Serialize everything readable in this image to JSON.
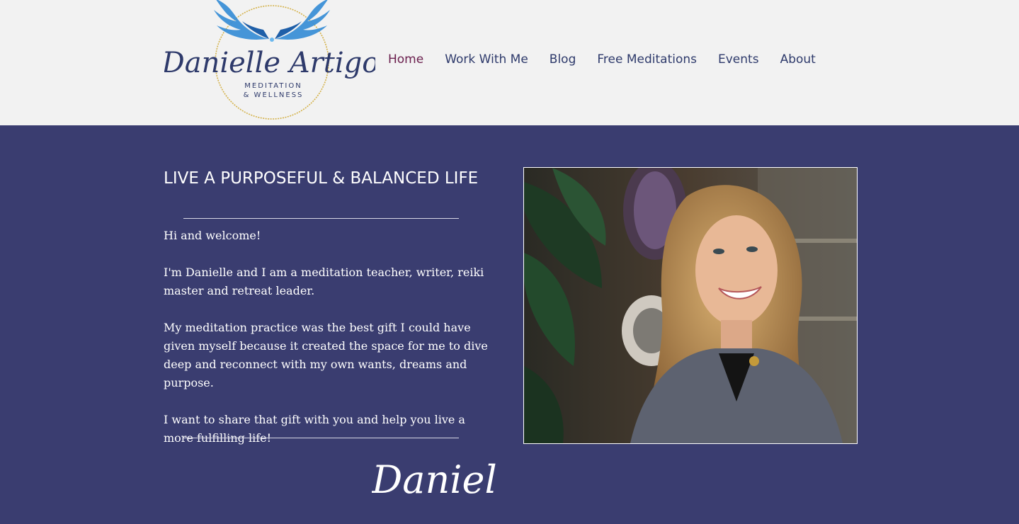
{
  "brand": {
    "logo_name": "Danielle Artigo",
    "logo_tagline_1": "MEDITATION",
    "logo_tagline_2": "& WELLNESS"
  },
  "nav": {
    "items": [
      {
        "label": "Home",
        "active": true
      },
      {
        "label": "Work With Me",
        "active": false
      },
      {
        "label": "Blog",
        "active": false
      },
      {
        "label": "Free Meditations",
        "active": false
      },
      {
        "label": "Events",
        "active": false
      },
      {
        "label": "About",
        "active": false
      }
    ]
  },
  "hero": {
    "title": "LIVE A PURPOSEFUL & BALANCED LIFE",
    "paragraphs": [
      "Hi and welcome!",
      "I'm Danielle and I am a meditation teacher, writer, reiki master and retreat leader.",
      "My meditation practice was the best gift I could have given myself because it created the space for me to dive deep and reconnect with my own wants, dreams and purpose.",
      "I want to share that gift with you and help you live a more fulfilling life!"
    ],
    "signature": "Danielle"
  },
  "colors": {
    "header_bg": "#f2f2f2",
    "main_bg": "#3a3d70",
    "nav_text": "#2e3a6b",
    "nav_active": "#6a1e4d",
    "wing_blue": "#3b8fd6",
    "gold": "#d4b24a"
  }
}
